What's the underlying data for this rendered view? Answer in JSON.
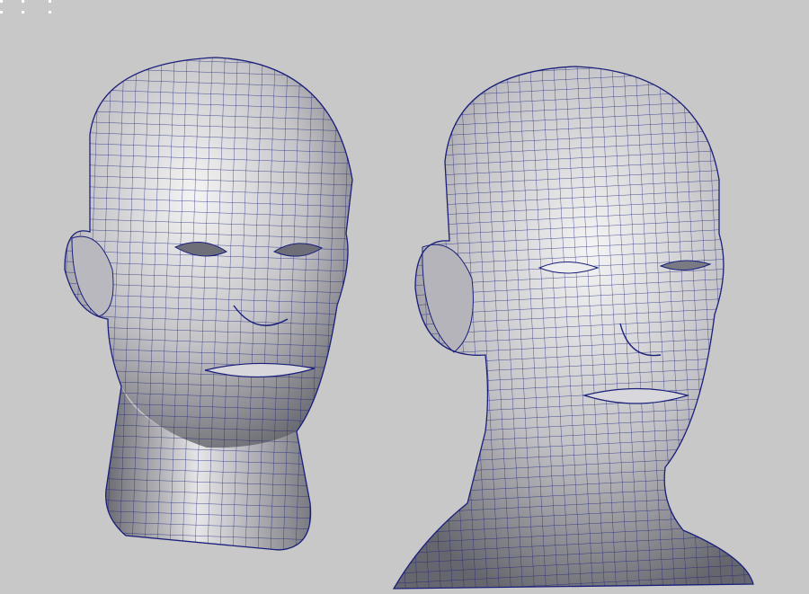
{
  "viewport": {
    "background": "#c8c8c8",
    "mesh_line_color": "#1a1f7a",
    "surface_light": "#f2f2f2",
    "surface_mid": "#b4b4b8",
    "surface_dark": "#5c5c66"
  },
  "models": [
    {
      "id": "head-young",
      "description_icon": "wireframe-head-icon"
    },
    {
      "id": "head-older",
      "description_icon": "wireframe-head-icon"
    }
  ]
}
